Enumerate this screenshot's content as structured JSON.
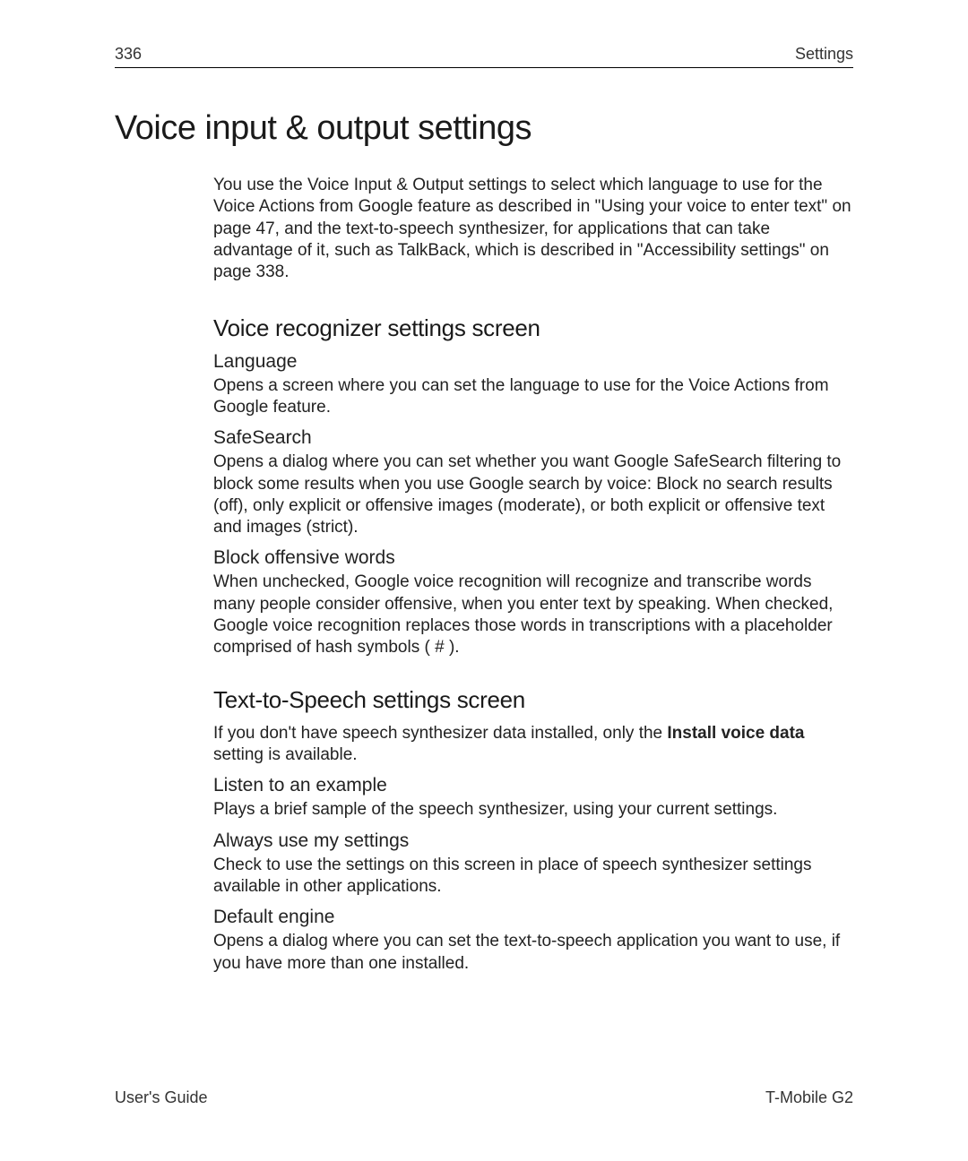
{
  "header": {
    "page_number": "336",
    "section_label": "Settings"
  },
  "title": "Voice input & output settings",
  "intro": "You use the Voice Input & Output settings to select which language to use for the Voice Actions from Google feature as described in \"Using your voice to enter text\" on page 47, and the text-to-speech synthesizer, for applications that can take advantage of it, such as TalkBack, which is described in \"Accessibility settings\" on page 338.",
  "section1": {
    "heading": "Voice recognizer settings screen",
    "items": {
      "language": {
        "title": "Language",
        "body": "Opens a screen where you can set the language to use for the Voice Actions from Google feature."
      },
      "safesearch": {
        "title": "SafeSearch",
        "body": "Opens a dialog where you can set whether you want Google SafeSearch filtering to block some results when you use Google search by voice: Block no search results (off), only explicit or offensive images (moderate), or both explicit or offensive text and images (strict)."
      },
      "block_offensive": {
        "title": "Block offensive words",
        "body": "When unchecked, Google voice recognition will recognize and transcribe words many people consider offensive, when you enter text by speaking. When checked, Google voice recognition replaces those words in transcriptions with a placeholder comprised of hash symbols ( # )."
      }
    }
  },
  "section2": {
    "heading": "Text-to-Speech settings screen",
    "intro_pre": "If you don't have speech synthesizer data installed, only the ",
    "intro_bold": "Install voice data",
    "intro_post": " setting is available.",
    "items": {
      "listen": {
        "title": "Listen to an example",
        "body": "Plays a brief sample of the speech synthesizer, using your current settings."
      },
      "always": {
        "title": "Always use my settings",
        "body": "Check to use the settings on this screen in place of speech synthesizer settings available in other applications."
      },
      "default_engine": {
        "title": "Default engine",
        "body": "Opens a dialog where you can set the text-to-speech application you want to use, if you have more than one installed."
      }
    }
  },
  "footer": {
    "left": "User's Guide",
    "right": "T-Mobile G2"
  }
}
